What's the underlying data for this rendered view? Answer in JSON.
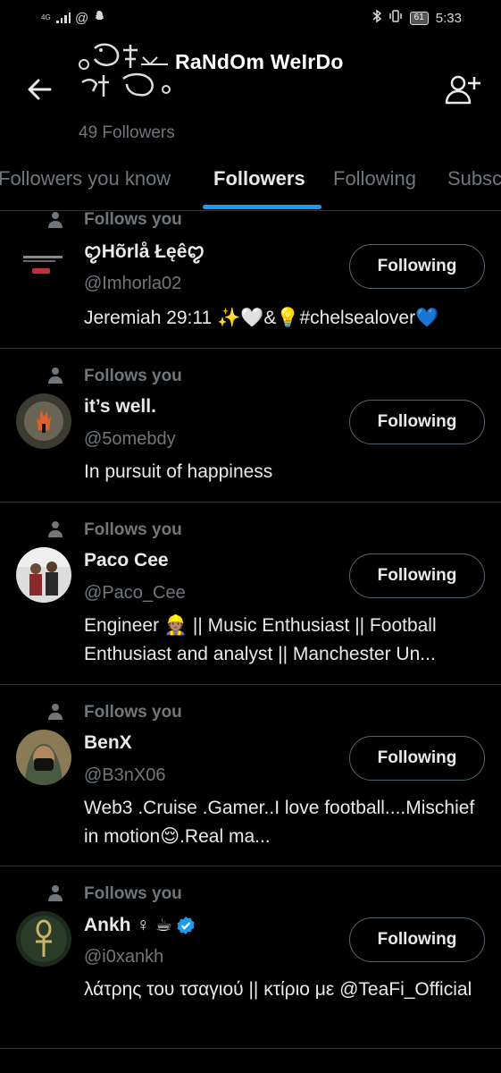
{
  "status_bar": {
    "network": "4G",
    "time": "5:33",
    "battery": "61"
  },
  "header": {
    "profile_name": "RaNdOm WeIrDo",
    "followers_count": "49 Followers"
  },
  "tabs": [
    {
      "label": "Followers you know"
    },
    {
      "label": "Followers"
    },
    {
      "label": "Following"
    },
    {
      "label": "Subsc"
    }
  ],
  "follows_you_label": "Follows you",
  "follow_button_label": "Following",
  "users": [
    {
      "name": "ꨄHõrlå Łęêꨄ",
      "handle": "@Imhorla02",
      "bio": "Jeremiah 29:11 ✨🤍&💡#chelsealover💙",
      "verified": false
    },
    {
      "name": "it’s well.",
      "handle": "@5omebdy",
      "bio": "In pursuit of happiness",
      "verified": false
    },
    {
      "name": "Paco Cee",
      "handle": "@Paco_Cee",
      "bio": "Engineer 👷🏽 ||  Music Enthusiast || Football Enthusiast and analyst || Manchester Un...",
      "verified": false
    },
    {
      "name": "BenX",
      "handle": "@B3nX06",
      "bio": "Web3 .Cruise .Gamer..I love football....Mischief in motion😌.Real ma...",
      "verified": false
    },
    {
      "name": "Ankh ♀ ☕",
      "handle": "@i0xankh",
      "bio": "λάτρης του τσαγιού || κτίριο με @TeaFi_Official",
      "verified": true
    }
  ],
  "colors": {
    "background": "#000000",
    "accent": "#1d9bf0",
    "secondary_text": "#71767b",
    "divider": "#2f3336"
  }
}
